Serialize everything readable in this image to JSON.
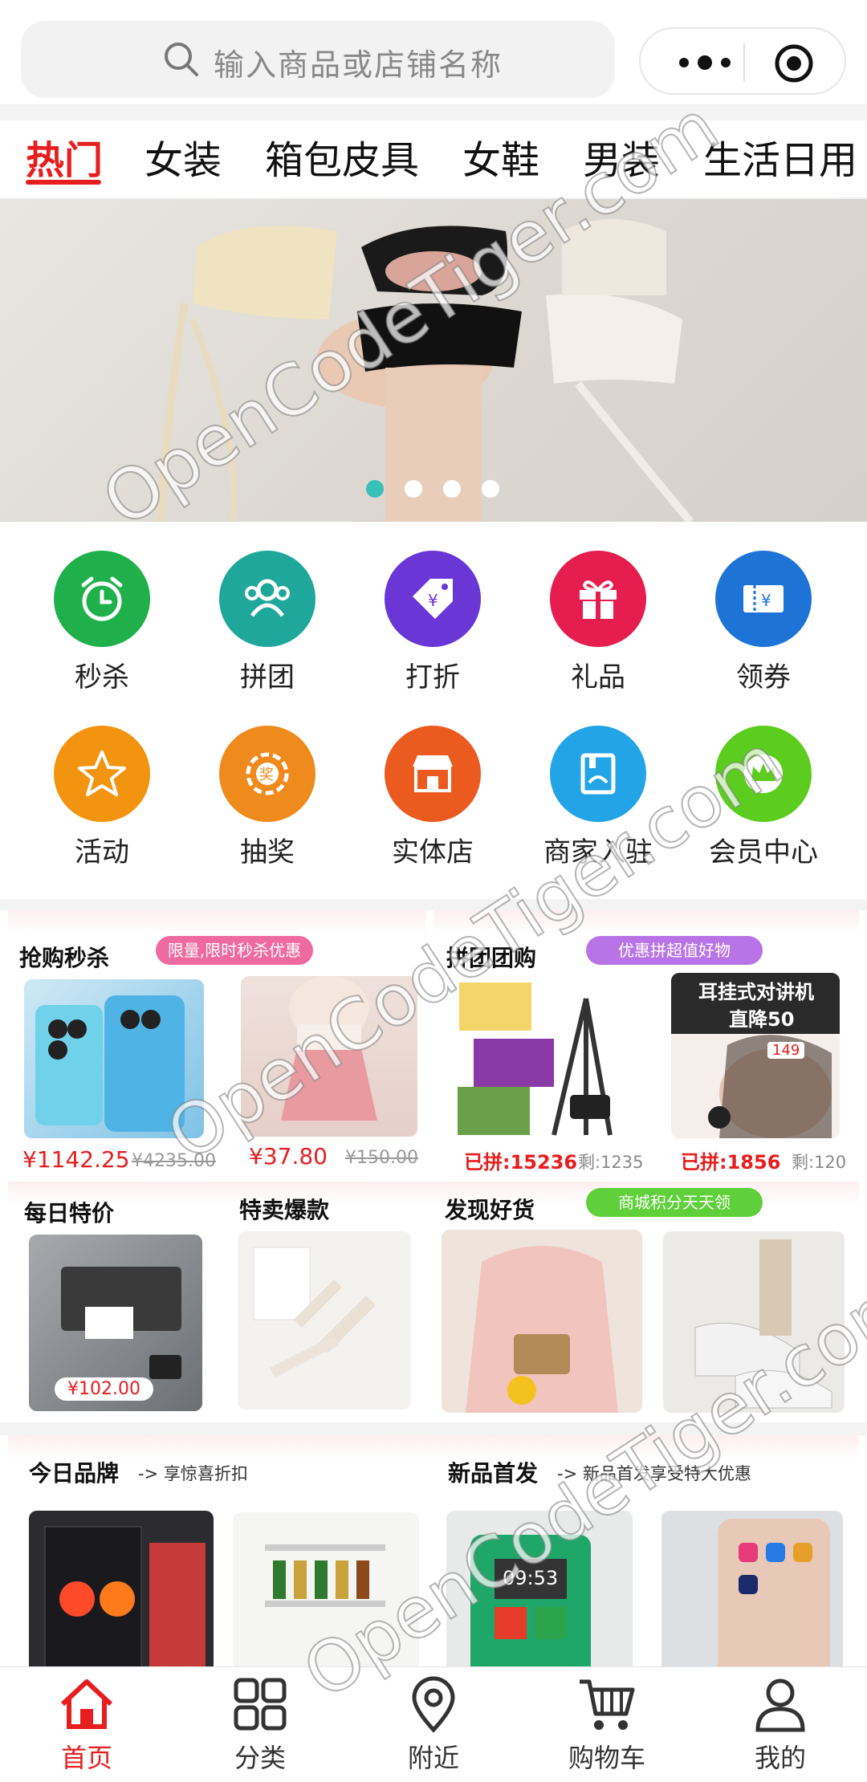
{
  "search": {
    "placeholder": "输入商品或店铺名称"
  },
  "tabs": [
    {
      "label": "热门",
      "active": true
    },
    {
      "label": "女装"
    },
    {
      "label": "箱包皮具"
    },
    {
      "label": "女鞋"
    },
    {
      "label": "男装"
    },
    {
      "label": "生活日用"
    }
  ],
  "banner": {
    "dots": 4,
    "active_dot": 1
  },
  "grid": [
    {
      "label": "秒杀",
      "icon": "alarm-clock-icon",
      "color": "#1fb04c"
    },
    {
      "label": "拼团",
      "icon": "group-icon",
      "color": "#1ea79a"
    },
    {
      "label": "打折",
      "icon": "price-tag-icon",
      "color": "#6a36d6"
    },
    {
      "label": "礼品",
      "icon": "gift-icon",
      "color": "#e51e4f"
    },
    {
      "label": "领券",
      "icon": "coupon-icon",
      "color": "#1e73d6"
    },
    {
      "label": "活动",
      "icon": "star-icon",
      "color": "#f39411"
    },
    {
      "label": "抽奖",
      "icon": "lottery-icon",
      "color": "#ef8a1c"
    },
    {
      "label": "实体店",
      "icon": "store-icon",
      "color": "#eb5a1e"
    },
    {
      "label": "商家入驻",
      "icon": "merchant-icon",
      "color": "#22a4e6"
    },
    {
      "label": "会员中心",
      "icon": "crown-icon",
      "color": "#5ccd1e"
    }
  ],
  "promo": {
    "flash": {
      "title": "抢购秒杀",
      "tag": "限量,限时秒杀优惠",
      "items": [
        {
          "price": "¥1142.25",
          "old_price": "¥4235.00"
        },
        {
          "price": "¥37.80",
          "old_price": "¥150.00"
        }
      ]
    },
    "group": {
      "title": "拼团团购",
      "tag": "优惠拼超值好物",
      "items": [
        {
          "sold": "已拼:15236",
          "left": "剩:1235"
        },
        {
          "sold": "已拼:1856",
          "left": "剩:120"
        }
      ],
      "ad_text1": "耳挂式对讲机",
      "ad_text2": "直降50",
      "ad_price": "149"
    },
    "daily": {
      "title": "每日特价",
      "price": "¥102.00"
    },
    "hot": {
      "title": "特卖爆款"
    },
    "discover": {
      "title": "发现好货",
      "tag": "商城积分天天领"
    }
  },
  "brands": {
    "today": {
      "title": "今日品牌",
      "sub": "-> 享惊喜折扣"
    },
    "new": {
      "title": "新品首发",
      "sub": "-> 新品首发享受特大优惠"
    }
  },
  "tabbar": [
    {
      "label": "首页",
      "icon": "home-icon",
      "active": true
    },
    {
      "label": "分类",
      "icon": "category-icon"
    },
    {
      "label": "附近",
      "icon": "location-icon"
    },
    {
      "label": "购物车",
      "icon": "cart-icon"
    },
    {
      "label": "我的",
      "icon": "user-icon"
    }
  ],
  "colors": {
    "accent": "#e61e1e",
    "active_dot": "#39c0b8"
  },
  "watermark": "OpenCodeTiger.com"
}
